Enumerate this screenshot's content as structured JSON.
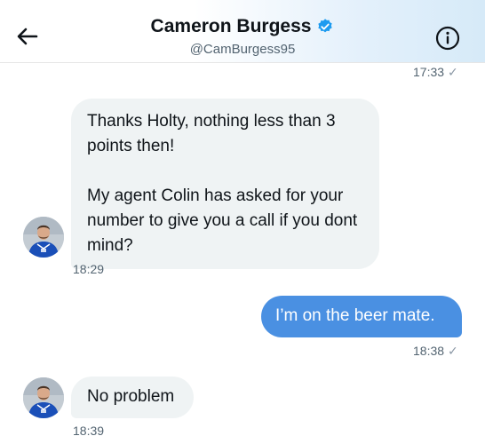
{
  "header": {
    "name": "Cameron Burgess",
    "handle": "@CamBurgess95",
    "back_icon": "back-arrow-icon",
    "info_icon": "info-icon",
    "verified_icon": "verified-badge-icon",
    "gradient_color": "#d6eaf8"
  },
  "messages": [
    {
      "kind": "timestamp",
      "time": "17:33",
      "check": "✓"
    },
    {
      "kind": "received",
      "paragraphs": [
        "Thanks Holty, nothing less than 3 points then!",
        "My agent Colin has asked for your number to give you a call if you dont mind?"
      ],
      "time": "18:29"
    },
    {
      "kind": "sent",
      "text": "I’m on the beer mate.",
      "time": "18:38",
      "check": "✓"
    },
    {
      "kind": "received",
      "paragraphs": [
        "No problem"
      ],
      "time": "18:39"
    }
  ],
  "colors": {
    "received_bubble": "#eff3f4",
    "sent_bubble": "#4a90e2",
    "verified": "#1d9bf0",
    "kit_blue": "#1a4fb8"
  }
}
